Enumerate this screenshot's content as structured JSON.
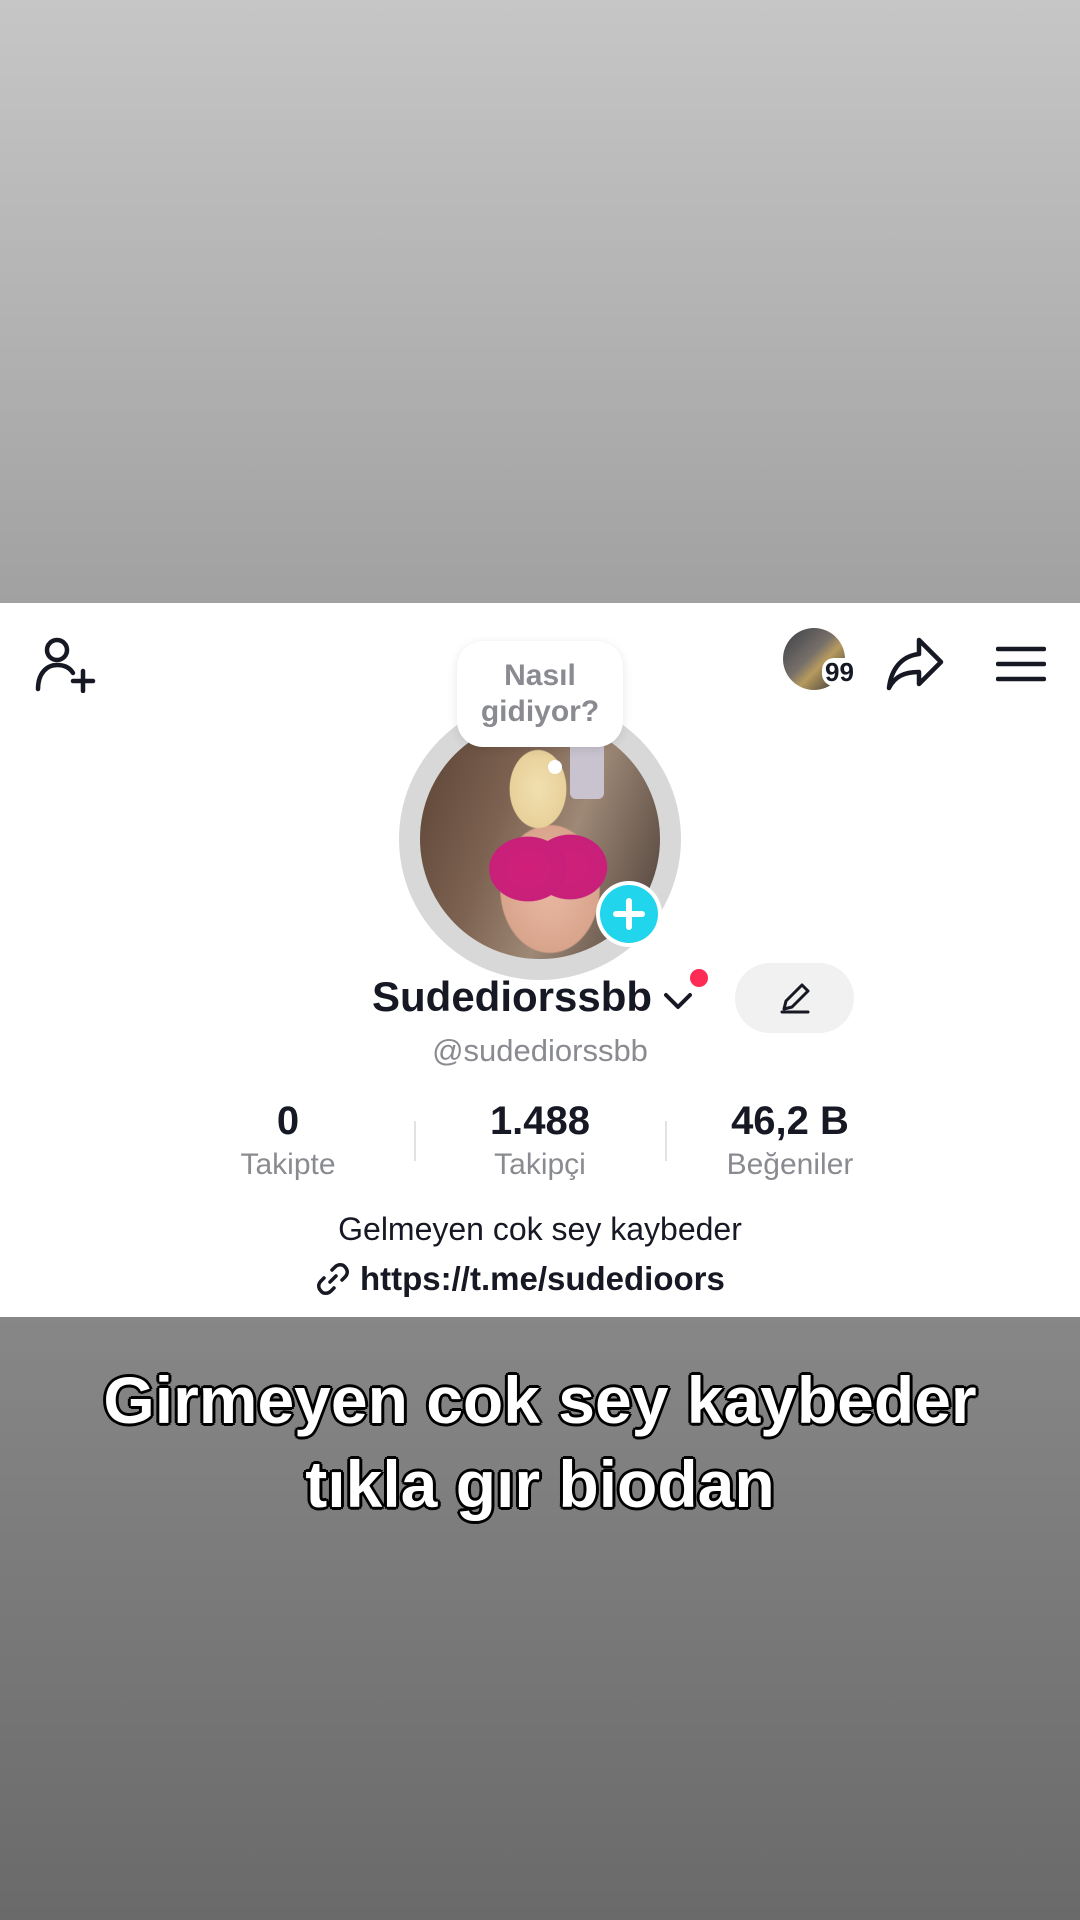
{
  "profile": {
    "status_bubble": [
      "Nasıl",
      "gidiyor?"
    ],
    "notification_count": "99",
    "display_name": "Sudediorssbb",
    "handle": "@sudediorssbb",
    "stats": [
      {
        "value": "0",
        "label": "Takipte"
      },
      {
        "value": "1.488",
        "label": "Takipçi"
      },
      {
        "value": "46,2 B",
        "label": "Beğeniler"
      }
    ],
    "bio": "Gelmeyen cok sey kaybeder",
    "link": "https://t.me/sudedioors"
  },
  "caption": {
    "lines": [
      "Girmeyen cok sey kaybeder",
      "tıkla gır biodan"
    ]
  },
  "icons": {
    "add_friend": "add-user-icon",
    "share": "share-arrow-icon",
    "menu": "hamburger-menu-icon",
    "edit": "pencil-icon",
    "link": "link-chain-icon",
    "add_story": "plus-icon"
  },
  "colors": {
    "accent_cyan": "#20d5ec",
    "notification_red": "#fe2c55",
    "text_primary": "#161823",
    "text_secondary": "#8a8b91"
  }
}
